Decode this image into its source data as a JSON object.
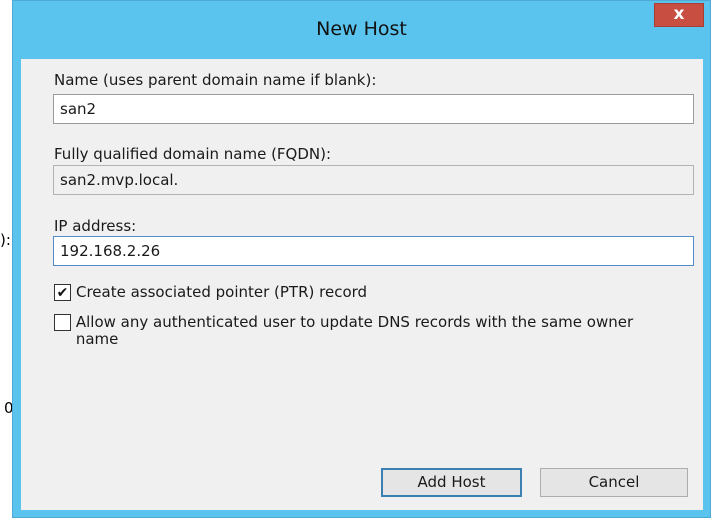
{
  "window": {
    "title": "New Host",
    "close_glyph": "x",
    "title_color": "#5ac3ee",
    "close_color": "#c74e41"
  },
  "background_fragments": [
    "):",
    "0"
  ],
  "form": {
    "name_label": "Name (uses parent domain name if blank):",
    "name_value": "san2",
    "fqdn_label": "Fully qualified domain name (FQDN):",
    "fqdn_value": "san2.mvp.local.",
    "ip_label": "IP address:",
    "ip_value": "192.168.2.26"
  },
  "options": [
    {
      "label": "Create associated pointer (PTR) record",
      "checked": true
    },
    {
      "label": "Allow any authenticated user to update DNS records with the same owner name",
      "checked": false
    }
  ],
  "buttons": {
    "add_host": "Add Host",
    "cancel": "Cancel"
  },
  "icons": {
    "close": "close-icon",
    "check": "checkmark-icon"
  }
}
